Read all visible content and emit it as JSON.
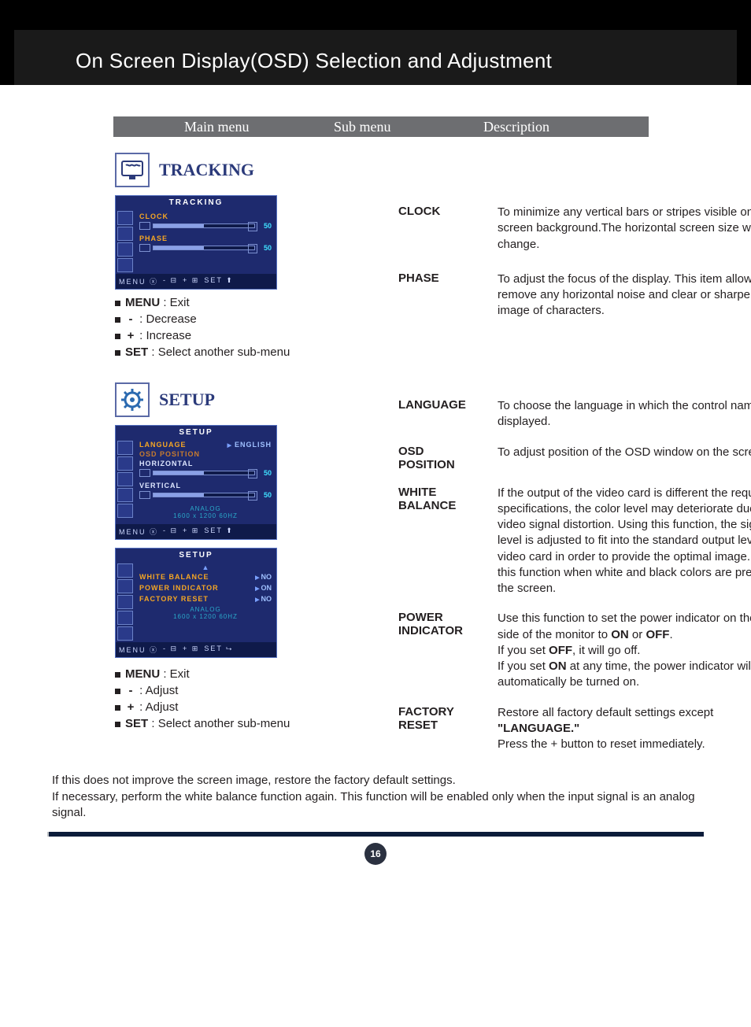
{
  "page_title": "On Screen Display(OSD) Selection and Adjustment",
  "col_headers": {
    "main": "Main menu",
    "sub": "Sub menu",
    "desc": "Description"
  },
  "tracking": {
    "title": "TRACKING",
    "osd": {
      "title": "TRACKING",
      "clock_label": "CLOCK",
      "clock_value": "50",
      "phase_label": "PHASE",
      "phase_value": "50",
      "footer_menu": "MENU ⓧ",
      "footer_minus": "- ⊟",
      "footer_plus": "+ ⊞",
      "footer_set": "SET ⬆"
    },
    "items": [
      {
        "label": "CLOCK",
        "desc": "To minimize any vertical bars or stripes visible on the screen background.The horizontal screen size will also change."
      },
      {
        "label": "PHASE",
        "desc": "To adjust the focus of the display. This item allows you to remove any horizontal noise and clear or sharpen the image of characters."
      }
    ],
    "legend": {
      "menu": "MENU",
      "menu_desc": " : Exit",
      "minus_desc": " : Decrease",
      "plus_desc": " : Increase",
      "set": "SET",
      "set_desc": " : Select another sub-menu"
    }
  },
  "setup": {
    "title": "SETUP",
    "osd1": {
      "title": "SETUP",
      "language_k": "LANGUAGE",
      "language_v": "ENGLISH",
      "osd_position": "OSD POSITION",
      "horizontal": "HORIZONTAL",
      "horizontal_v": "50",
      "vertical": "VERTICAL",
      "vertical_v": "50",
      "analog": "ANALOG",
      "analog_res": "1600 x 1200 60HZ",
      "footer_menu": "MENU ⓧ",
      "footer_minus": "- ⊟",
      "footer_plus": "+ ⊞",
      "footer_set": "SET ⬆"
    },
    "osd2": {
      "title": "SETUP",
      "wb_k": "WHITE BALANCE",
      "wb_v": "NO",
      "pi_k": "POWER INDICATOR",
      "pi_v": "ON",
      "fr_k": "FACTORY RESET",
      "fr_v": "NO",
      "analog": "ANALOG",
      "analog_res": "1600 x 1200 60HZ",
      "footer_menu": "MENU ⓧ",
      "footer_minus": "- ⊟",
      "footer_plus": "+ ⊞",
      "footer_set": "SET ⮡"
    },
    "legend": {
      "menu": "MENU",
      "menu_desc": " : Exit",
      "minus_desc": " : Adjust",
      "plus_desc": " : Adjust",
      "set": "SET",
      "set_desc": " : Select another sub-menu"
    },
    "items": [
      {
        "label": "LANGUAGE",
        "desc": "To choose the language in which the control names are displayed."
      },
      {
        "label": "OSD POSITION",
        "desc": "To adjust position of the OSD window on the screen."
      },
      {
        "label": "WHITE BALANCE",
        "desc": "If the output of the video card is different the required specifications, the color level may deteriorate due to video signal distortion. Using this function, the signal level is adjusted to fit into the standard output level of the video card in order to provide the optimal image. Activate this function when white and black colors are present in the screen."
      },
      {
        "label": "POWER INDICATOR",
        "desc_pre": "Use this function to set the power indicator on the front side of the monitor to ",
        "on": "ON",
        "or": " or ",
        "off": "OFF",
        "period": ".",
        "l2a": "If you set ",
        "l2b": "OFF",
        "l2c": ", it will go off.",
        "l3a": "If you set ",
        "l3b": "ON",
        "l3c": " at any time, the power indicator will automatically be turned on."
      },
      {
        "label": "FACTORY RESET",
        "desc_pre": "Restore all factory default settings except ",
        "lang": "\"LANGUAGE.\"",
        "l2a": "Press the ",
        "l2b_plus": "+",
        "l2c": "  button to reset immediately."
      }
    ]
  },
  "note1": "If this does not improve the screen image, restore the factory default settings.",
  "note2": "If necessary, perform the white balance function again. This function will be enabled only when the input signal is an analog signal.",
  "page_number": "16"
}
